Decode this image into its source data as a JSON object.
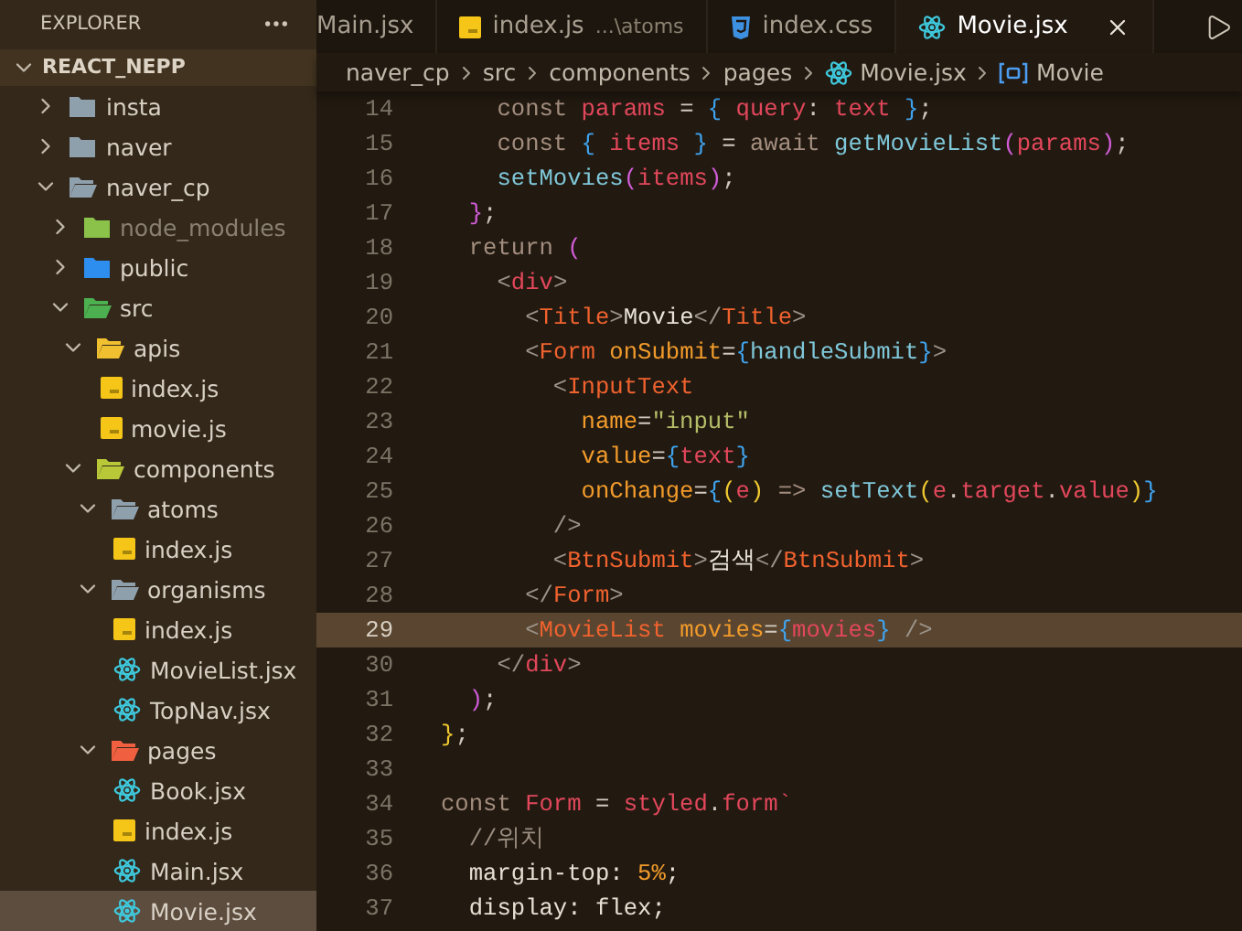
{
  "sidebar": {
    "title": "EXPLORER",
    "root": {
      "label": "REACT_NEPP",
      "expanded": true
    },
    "items": [
      {
        "label": "insta",
        "kind": "folder",
        "expanded": false,
        "selected": false
      },
      {
        "label": "naver",
        "kind": "folder",
        "expanded": false,
        "selected": false
      },
      {
        "label": "naver_cp",
        "kind": "folder",
        "expanded": true,
        "selected": false,
        "children": [
          {
            "label": "node_modules",
            "kind": "node",
            "expanded": false,
            "dimmed": true,
            "selected": false
          },
          {
            "label": "public",
            "kind": "public",
            "expanded": false,
            "selected": false
          },
          {
            "label": "src",
            "kind": "src",
            "expanded": true,
            "selected": false,
            "children": [
              {
                "label": "apis",
                "kind": "apis",
                "expanded": true,
                "selected": false,
                "children": [
                  {
                    "label": "index.js",
                    "kind": "js",
                    "selected": false
                  },
                  {
                    "label": "movie.js",
                    "kind": "js",
                    "selected": false
                  }
                ]
              },
              {
                "label": "components",
                "kind": "components",
                "expanded": true,
                "selected": false,
                "children": [
                  {
                    "label": "atoms",
                    "kind": "folder",
                    "expanded": true,
                    "selected": false,
                    "children": [
                      {
                        "label": "index.js",
                        "kind": "js",
                        "selected": false
                      }
                    ]
                  },
                  {
                    "label": "organisms",
                    "kind": "folder",
                    "expanded": true,
                    "selected": false,
                    "children": [
                      {
                        "label": "index.js",
                        "kind": "js",
                        "selected": false
                      },
                      {
                        "label": "MovieList.jsx",
                        "kind": "react",
                        "selected": false
                      },
                      {
                        "label": "TopNav.jsx",
                        "kind": "react",
                        "selected": false
                      }
                    ]
                  },
                  {
                    "label": "pages",
                    "kind": "pages",
                    "expanded": true,
                    "selected": false,
                    "children": [
                      {
                        "label": "Book.jsx",
                        "kind": "react",
                        "selected": false
                      },
                      {
                        "label": "index.js",
                        "kind": "js",
                        "selected": false
                      },
                      {
                        "label": "Main.jsx",
                        "kind": "react",
                        "selected": false
                      },
                      {
                        "label": "Movie.jsx",
                        "kind": "react",
                        "selected": true
                      }
                    ]
                  }
                ]
              }
            ]
          }
        ]
      }
    ]
  },
  "tabs": [
    {
      "label": "Main.jsx",
      "kind": "plain",
      "selected": false
    },
    {
      "label": "index.js",
      "description": "...\\atoms",
      "kind": "js",
      "selected": false
    },
    {
      "label": "index.css",
      "kind": "css",
      "selected": false
    },
    {
      "label": "Movie.jsx",
      "kind": "react",
      "selected": true
    }
  ],
  "breadcrumbs": [
    {
      "label": "naver_cp",
      "kind": "plain"
    },
    {
      "label": "src",
      "kind": "plain"
    },
    {
      "label": "components",
      "kind": "plain"
    },
    {
      "label": "pages",
      "kind": "plain"
    },
    {
      "label": "Movie.jsx",
      "kind": "react"
    },
    {
      "label": "Movie",
      "kind": "symbol"
    }
  ],
  "editor": {
    "lines": [
      {
        "number": "14",
        "current": false,
        "tokens": [
          {
            "kind": "keyword",
            "text": "    const "
          },
          {
            "kind": "var",
            "text": "params "
          },
          {
            "kind": "op",
            "text": "= "
          },
          {
            "kind": "brace3",
            "text": "{ "
          },
          {
            "kind": "var",
            "text": "query"
          },
          {
            "kind": "op",
            "text": ": "
          },
          {
            "kind": "var",
            "text": "text "
          },
          {
            "kind": "brace3",
            "text": "}"
          },
          {
            "kind": "op",
            "text": ";"
          }
        ]
      },
      {
        "number": "15",
        "current": false,
        "tokens": [
          {
            "kind": "keyword",
            "text": "    const "
          },
          {
            "kind": "brace3",
            "text": "{ "
          },
          {
            "kind": "var",
            "text": "items "
          },
          {
            "kind": "brace3",
            "text": "} "
          },
          {
            "kind": "op",
            "text": "= "
          },
          {
            "kind": "keyword",
            "text": "await "
          },
          {
            "kind": "func",
            "text": "getMovieList"
          },
          {
            "kind": "brace2",
            "text": "("
          },
          {
            "kind": "var",
            "text": "params"
          },
          {
            "kind": "brace2",
            "text": ")"
          },
          {
            "kind": "op",
            "text": ";"
          }
        ]
      },
      {
        "number": "16",
        "current": false,
        "tokens": [
          {
            "kind": "func",
            "text": "    setMovies"
          },
          {
            "kind": "brace2",
            "text": "("
          },
          {
            "kind": "var",
            "text": "items"
          },
          {
            "kind": "brace2",
            "text": ")"
          },
          {
            "kind": "op",
            "text": ";"
          }
        ]
      },
      {
        "number": "17",
        "current": false,
        "tokens": [
          {
            "kind": "brace2",
            "text": "  }"
          },
          {
            "kind": "op",
            "text": ";"
          }
        ]
      },
      {
        "number": "18",
        "current": false,
        "tokens": [
          {
            "kind": "keyword",
            "text": "  return "
          },
          {
            "kind": "brace2",
            "text": "("
          }
        ]
      },
      {
        "number": "19",
        "current": false,
        "tokens": [
          {
            "kind": "punct",
            "text": "    <"
          },
          {
            "kind": "var",
            "text": "div"
          },
          {
            "kind": "punct",
            "text": ">"
          }
        ]
      },
      {
        "number": "20",
        "current": false,
        "tokens": [
          {
            "kind": "punct",
            "text": "      <"
          },
          {
            "kind": "tag",
            "text": "Title"
          },
          {
            "kind": "punct",
            "text": ">"
          },
          {
            "kind": "text",
            "text": "Movie"
          },
          {
            "kind": "punct",
            "text": "</"
          },
          {
            "kind": "tag",
            "text": "Title"
          },
          {
            "kind": "punct",
            "text": ">"
          }
        ]
      },
      {
        "number": "21",
        "current": false,
        "tokens": [
          {
            "kind": "punct",
            "text": "      <"
          },
          {
            "kind": "tag",
            "text": "Form "
          },
          {
            "kind": "attr",
            "text": "onSubmit"
          },
          {
            "kind": "op",
            "text": "="
          },
          {
            "kind": "brace3",
            "text": "{"
          },
          {
            "kind": "func",
            "text": "handleSubmit"
          },
          {
            "kind": "brace3",
            "text": "}"
          },
          {
            "kind": "punct",
            "text": ">"
          }
        ]
      },
      {
        "number": "22",
        "current": false,
        "tokens": [
          {
            "kind": "punct",
            "text": "        <"
          },
          {
            "kind": "tag",
            "text": "InputText"
          }
        ]
      },
      {
        "number": "23",
        "current": false,
        "tokens": [
          {
            "kind": "attr",
            "text": "          name"
          },
          {
            "kind": "op",
            "text": "="
          },
          {
            "kind": "string",
            "text": "\"input\""
          }
        ]
      },
      {
        "number": "24",
        "current": false,
        "tokens": [
          {
            "kind": "attr",
            "text": "          value"
          },
          {
            "kind": "op",
            "text": "="
          },
          {
            "kind": "brace3",
            "text": "{"
          },
          {
            "kind": "var",
            "text": "text"
          },
          {
            "kind": "brace3",
            "text": "}"
          }
        ]
      },
      {
        "number": "25",
        "current": false,
        "tokens": [
          {
            "kind": "attr",
            "text": "          onChange"
          },
          {
            "kind": "op",
            "text": "="
          },
          {
            "kind": "brace3",
            "text": "{"
          },
          {
            "kind": "brace1",
            "text": "("
          },
          {
            "kind": "var",
            "text": "e"
          },
          {
            "kind": "brace1",
            "text": ") "
          },
          {
            "kind": "keyword",
            "text": "=> "
          },
          {
            "kind": "func",
            "text": "setText"
          },
          {
            "kind": "brace1",
            "text": "("
          },
          {
            "kind": "var",
            "text": "e"
          },
          {
            "kind": "op",
            "text": "."
          },
          {
            "kind": "var",
            "text": "target"
          },
          {
            "kind": "op",
            "text": "."
          },
          {
            "kind": "var",
            "text": "value"
          },
          {
            "kind": "brace1",
            "text": ")"
          },
          {
            "kind": "brace3",
            "text": "}"
          }
        ]
      },
      {
        "number": "26",
        "current": false,
        "tokens": [
          {
            "kind": "punct",
            "text": "        />"
          }
        ]
      },
      {
        "number": "27",
        "current": false,
        "tokens": [
          {
            "kind": "punct",
            "text": "        <"
          },
          {
            "kind": "tag",
            "text": "BtnSubmit"
          },
          {
            "kind": "punct",
            "text": ">"
          },
          {
            "kind": "text",
            "text": "검색"
          },
          {
            "kind": "punct",
            "text": "</"
          },
          {
            "kind": "tag",
            "text": "BtnSubmit"
          },
          {
            "kind": "punct",
            "text": ">"
          }
        ]
      },
      {
        "number": "28",
        "current": false,
        "tokens": [
          {
            "kind": "punct",
            "text": "      </"
          },
          {
            "kind": "tag",
            "text": "Form"
          },
          {
            "kind": "punct",
            "text": ">"
          }
        ]
      },
      {
        "number": "29",
        "current": true,
        "tokens": [
          {
            "kind": "punct",
            "text": "      <"
          },
          {
            "kind": "tag",
            "text": "MovieList "
          },
          {
            "kind": "attr",
            "text": "movies"
          },
          {
            "kind": "op",
            "text": "="
          },
          {
            "kind": "brace3",
            "text": "{"
          },
          {
            "kind": "var",
            "text": "movies"
          },
          {
            "kind": "brace3",
            "text": "}"
          },
          {
            "kind": "punct",
            "text": " />"
          }
        ]
      },
      {
        "number": "30",
        "current": false,
        "tokens": [
          {
            "kind": "punct",
            "text": "    </"
          },
          {
            "kind": "var",
            "text": "div"
          },
          {
            "kind": "punct",
            "text": ">"
          }
        ]
      },
      {
        "number": "31",
        "current": false,
        "tokens": [
          {
            "kind": "brace2",
            "text": "  )"
          },
          {
            "kind": "op",
            "text": ";"
          }
        ]
      },
      {
        "number": "32",
        "current": false,
        "tokens": [
          {
            "kind": "brace1",
            "text": "}"
          },
          {
            "kind": "op",
            "text": ";"
          }
        ]
      },
      {
        "number": "33",
        "current": false
      },
      {
        "number": "34",
        "current": false,
        "tokens": [
          {
            "kind": "keyword",
            "text": "const "
          },
          {
            "kind": "var",
            "text": "Form "
          },
          {
            "kind": "op",
            "text": "= "
          },
          {
            "kind": "var",
            "text": "styled"
          },
          {
            "kind": "op",
            "text": "."
          },
          {
            "kind": "var",
            "text": "form"
          },
          {
            "kind": "string2",
            "text": "`"
          }
        ]
      },
      {
        "number": "35",
        "current": false,
        "tokens": [
          {
            "kind": "comment",
            "text": "  //위치"
          }
        ]
      },
      {
        "number": "36",
        "current": false,
        "tokens": [
          {
            "kind": "css",
            "text": "  margin-top: "
          },
          {
            "kind": "number",
            "text": "5%"
          },
          {
            "kind": "css",
            "text": ";"
          }
        ]
      },
      {
        "number": "37",
        "current": false,
        "tokens": [
          {
            "kind": "css",
            "text": "  display: flex;"
          }
        ]
      }
    ]
  }
}
